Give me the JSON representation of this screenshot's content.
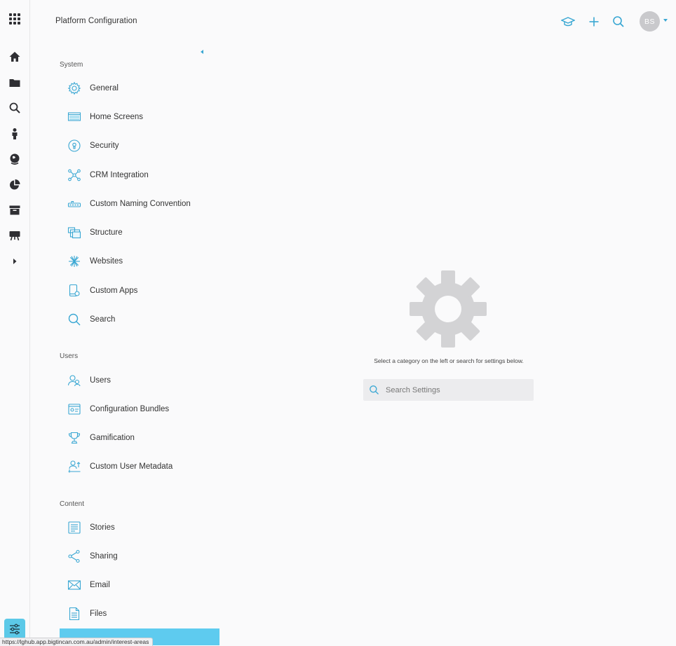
{
  "header": {
    "title": "Platform Configuration",
    "avatar_initials": "BS",
    "icons": [
      "learning-cap-icon",
      "plus-icon",
      "search-icon"
    ]
  },
  "rail": {
    "icons": [
      "apps-grid-icon",
      "home-icon",
      "folder-icon",
      "search-icon",
      "person-icon",
      "globe-icon",
      "pie-chart-icon",
      "archive-icon",
      "presentation-icon",
      "expand-arrow-icon",
      "settings-sliders-icon"
    ]
  },
  "nav": {
    "sections": [
      {
        "label": "System",
        "items": [
          {
            "label": "General",
            "icon": "gear-icon"
          },
          {
            "label": "Home Screens",
            "icon": "home-screens-icon"
          },
          {
            "label": "Security",
            "icon": "security-icon"
          },
          {
            "label": "CRM Integration",
            "icon": "crm-icon"
          },
          {
            "label": "Custom Naming Convention",
            "icon": "naming-icon"
          },
          {
            "label": "Structure",
            "icon": "structure-icon"
          },
          {
            "label": "Websites",
            "icon": "websites-icon"
          },
          {
            "label": "Custom Apps",
            "icon": "custom-apps-icon"
          },
          {
            "label": "Search",
            "icon": "search-icon"
          }
        ]
      },
      {
        "label": "Users",
        "items": [
          {
            "label": "Users",
            "icon": "users-icon"
          },
          {
            "label": "Configuration Bundles",
            "icon": "bundles-icon"
          },
          {
            "label": "Gamification",
            "icon": "trophy-icon"
          },
          {
            "label": "Custom User Metadata",
            "icon": "metadata-icon"
          }
        ]
      },
      {
        "label": "Content",
        "items": [
          {
            "label": "Stories",
            "icon": "stories-icon"
          },
          {
            "label": "Sharing",
            "icon": "share-icon"
          },
          {
            "label": "Email",
            "icon": "email-icon"
          },
          {
            "label": "Files",
            "icon": "file-icon"
          }
        ]
      }
    ]
  },
  "main": {
    "hint": "Select a category on the left or search for settings below.",
    "search_placeholder": "Search Settings"
  },
  "status_url": "https://lghub.app.bigtincan.com.au/admin/interest-areas",
  "colors": {
    "accent": "#39a7d3",
    "selected": "#5ecbef",
    "rail_icon": "#2f2f33",
    "gear": "#d3d3d5"
  }
}
